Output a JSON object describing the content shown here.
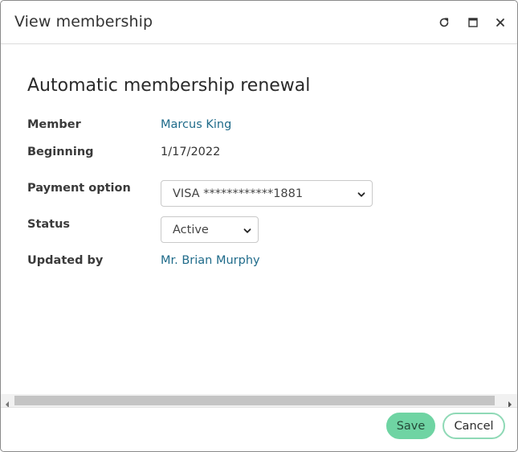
{
  "window": {
    "title": "View membership",
    "controls": [
      {
        "name": "refresh-icon"
      },
      {
        "name": "maximize-icon"
      },
      {
        "name": "close-icon"
      }
    ]
  },
  "main": {
    "heading": "Automatic membership renewal",
    "fields": {
      "member": {
        "label": "Member",
        "value": "Marcus King"
      },
      "beginning": {
        "label": "Beginning",
        "value": "1/17/2022"
      },
      "payment_option": {
        "label": "Payment option",
        "selected": "VISA ************1881"
      },
      "status": {
        "label": "Status",
        "selected": "Active"
      },
      "updated_by": {
        "label": "Updated by",
        "value": "Mr. Brian Murphy"
      }
    }
  },
  "footer": {
    "save_label": "Save",
    "cancel_label": "Cancel"
  },
  "colors": {
    "link": "#1f6b8a",
    "save_button": "#6fd4a3",
    "cancel_border": "#8fd9b6"
  }
}
